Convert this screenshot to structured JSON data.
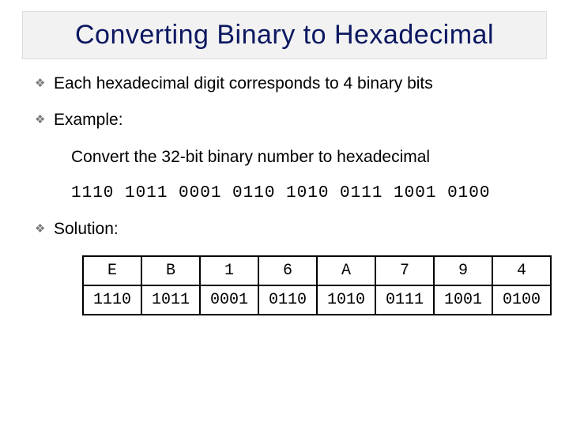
{
  "title": "Converting Binary to Hexadecimal",
  "bullets": {
    "b1": "Each hexadecimal digit corresponds to 4 binary bits",
    "b2": "Example:",
    "b3": "Solution:"
  },
  "example": {
    "prompt": "Convert the 32-bit binary number to hexadecimal",
    "binary": "1110 1011 0001 0110 1010 0111 1001 0100"
  },
  "solution": {
    "hex": [
      "E",
      "B",
      "1",
      "6",
      "A",
      "7",
      "9",
      "4"
    ],
    "nibble": [
      "1110",
      "1011",
      "0001",
      "0110",
      "1010",
      "0111",
      "1001",
      "0100"
    ]
  }
}
